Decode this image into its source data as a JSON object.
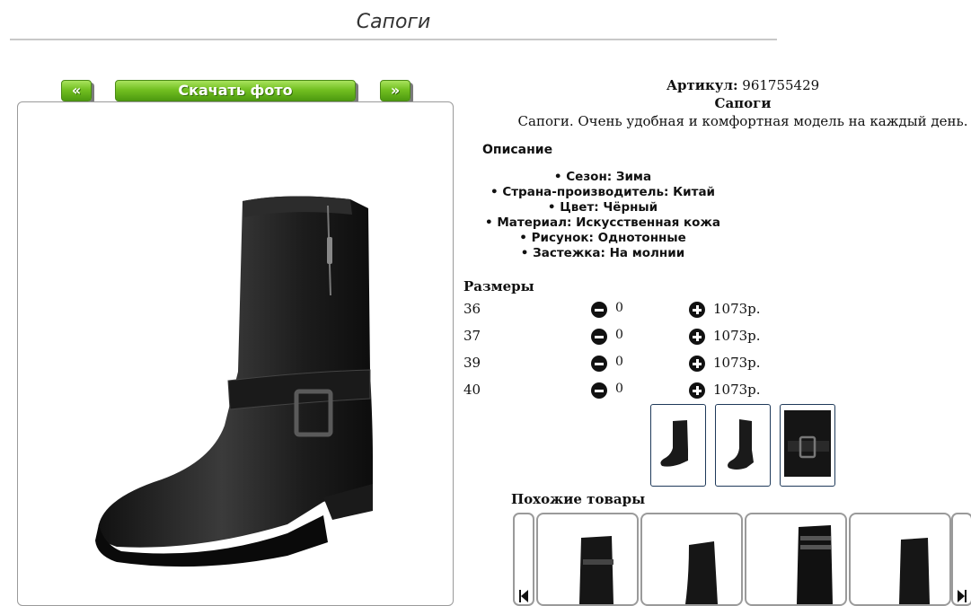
{
  "page": {
    "title": "Сапоги"
  },
  "gallery": {
    "prev_label": "«",
    "download_label": "Скачать фото",
    "next_label": "»"
  },
  "product": {
    "article_label": "Артикул:",
    "article_value": "961755429",
    "name": "Сапоги",
    "description": "Сапоги. Очень удобная и комфортная модель на каждый день."
  },
  "description": {
    "heading": "Описание",
    "properties": [
      "Сезон: Зима",
      "Страна-производитель: Китай",
      "Цвет: Чёрный",
      "Материал: Искусственная кожа",
      "Рисунок: Однотонные",
      "Застежка: На молнии"
    ]
  },
  "sizes": {
    "heading": "Размеры",
    "rows": [
      {
        "size": "36",
        "qty": "0",
        "price": "1073р."
      },
      {
        "size": "37",
        "qty": "0",
        "price": "1073р."
      },
      {
        "size": "39",
        "qty": "0",
        "price": "1073р."
      },
      {
        "size": "40",
        "qty": "0",
        "price": "1073р."
      }
    ]
  },
  "similar": {
    "heading": "Похожие товары"
  },
  "icons": {
    "minus": "minus-circle-icon",
    "plus": "plus-circle-icon",
    "carousel_prev": "skip-previous-icon",
    "carousel_next": "skip-next-icon"
  },
  "colors": {
    "button_green": "#73c021",
    "title_rule": "#c8c8c8",
    "thumb_border": "#1f3a5a"
  }
}
